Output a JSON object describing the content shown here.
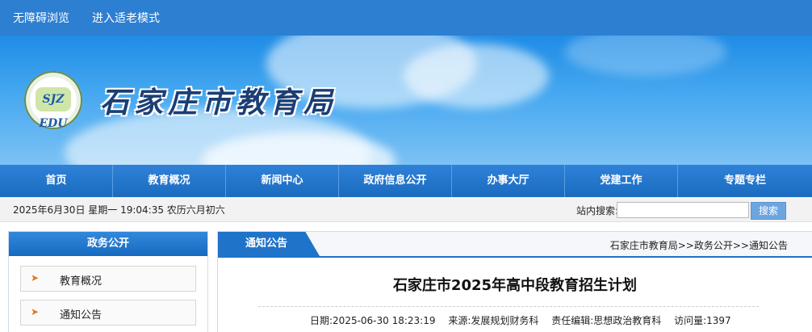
{
  "topbar": {
    "accessible": "无障碍浏览",
    "elder": "进入适老模式"
  },
  "banner": {
    "emblem_text": "SJZ EDU",
    "title": "石家庄市教育局"
  },
  "nav": {
    "items": [
      {
        "label": "首页"
      },
      {
        "label": "教育概况"
      },
      {
        "label": "新闻中心"
      },
      {
        "label": "政府信息公开"
      },
      {
        "label": "办事大厅"
      },
      {
        "label": "党建工作"
      },
      {
        "label": "专题专栏"
      }
    ]
  },
  "info": {
    "datetime": "2025年6月30日 星期一 19:04:35 农历六月初六",
    "search_label": "站内搜索:",
    "search_value": "",
    "search_button": "搜索"
  },
  "sidebar": {
    "title": "政务公开",
    "items": [
      {
        "arrow": "➤",
        "label": "教育概况"
      },
      {
        "arrow": "➤",
        "label": "通知公告"
      }
    ]
  },
  "panel": {
    "tab": "通知公告",
    "breadcrumb": [
      "石家庄市教育局",
      ">>政务公开",
      ">>通知公告"
    ],
    "article": {
      "title": "石家庄市2025年高中段教育招生计划",
      "date": "日期:2025-06-30 18:23:19",
      "source": "来源:发展规划财务科",
      "editor": "责任编辑:思想政治教育科",
      "views": "访问量:1397"
    }
  },
  "colors": {
    "primary": "#1f73c9",
    "nav": "#2f82d8",
    "arrow": "#e07a1c"
  }
}
